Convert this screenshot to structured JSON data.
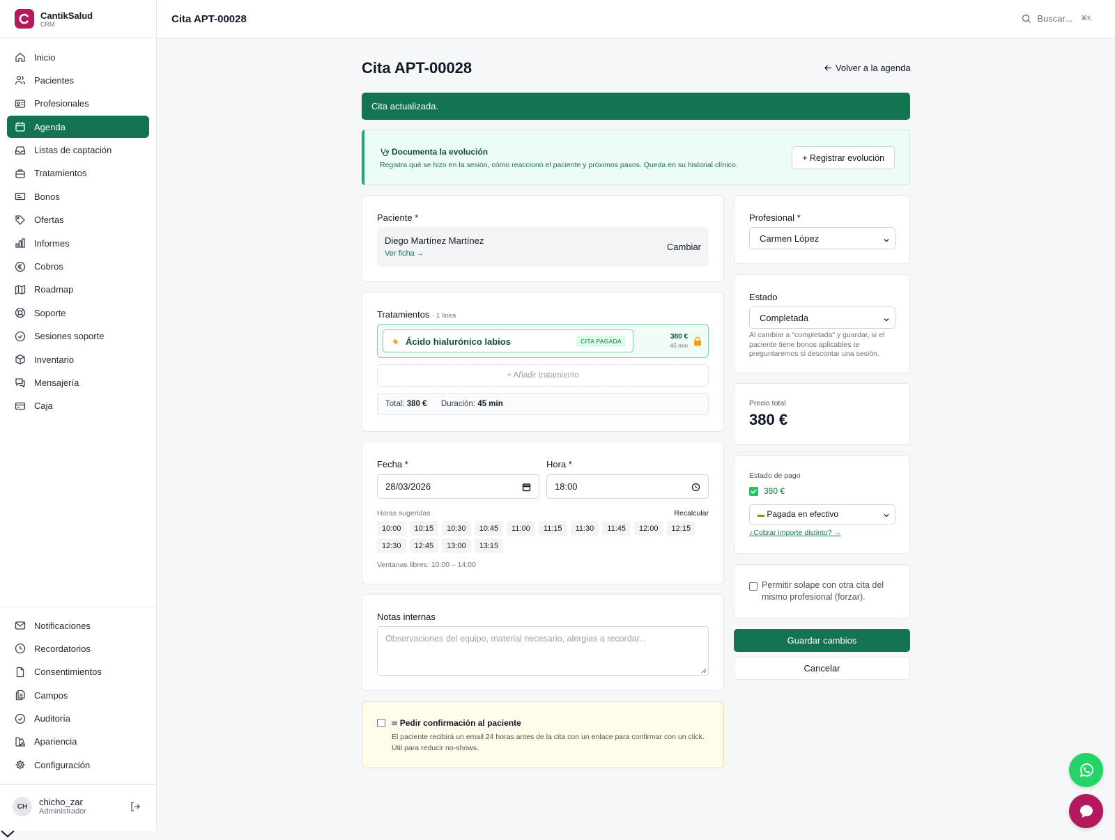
{
  "brand": {
    "name": "CantikSalud",
    "sub": "CRM"
  },
  "nav_top": [
    {
      "label": "Inicio",
      "icon": "home-icon"
    },
    {
      "label": "Pacientes",
      "icon": "users-icon"
    },
    {
      "label": "Profesionales",
      "icon": "id-card-icon"
    },
    {
      "label": "Agenda",
      "icon": "calendar-icon",
      "active": true
    },
    {
      "label": "Listas de captación",
      "icon": "inbox-icon"
    },
    {
      "label": "Tratamientos",
      "icon": "briefcase-icon"
    },
    {
      "label": "Bonos",
      "icon": "ticket-icon"
    },
    {
      "label": "Ofertas",
      "icon": "tag-icon"
    },
    {
      "label": "Informes",
      "icon": "bar-chart-icon"
    },
    {
      "label": "Cobros",
      "icon": "euro-icon"
    },
    {
      "label": "Roadmap",
      "icon": "map-icon"
    },
    {
      "label": "Soporte",
      "icon": "lifebuoy-icon"
    },
    {
      "label": "Sesiones soporte",
      "icon": "check-circle-icon"
    },
    {
      "label": "Inventario",
      "icon": "box-icon"
    },
    {
      "label": "Mensajería",
      "icon": "message-icon"
    },
    {
      "label": "Caja",
      "icon": "credit-card-icon"
    }
  ],
  "nav_bottom": [
    {
      "label": "Notificaciones",
      "icon": "mail-icon"
    },
    {
      "label": "Recordatorios",
      "icon": "clock-icon"
    },
    {
      "label": "Consentimientos",
      "icon": "file-icon"
    },
    {
      "label": "Campos",
      "icon": "files-icon"
    },
    {
      "label": "Auditoría",
      "icon": "shield-check-icon"
    },
    {
      "label": "Apariencia",
      "icon": "palette-icon"
    },
    {
      "label": "Configuración",
      "icon": "settings-icon"
    }
  ],
  "user": {
    "initials": "CH",
    "name": "chicho_zar",
    "role": "Administrador"
  },
  "topbar": {
    "title": "Cita APT-00028",
    "search_placeholder": "Buscar...",
    "shortcut": "⌘K"
  },
  "page": {
    "title": "Cita APT-00028",
    "back_label": "Volver a la agenda"
  },
  "alert": {
    "message": "Cita actualizada."
  },
  "evolution": {
    "title": "Documenta la evolución",
    "description": "Registra qué se hizo en la sesión, cómo reaccionó el paciente y próximos pasos. Queda en su historial clínico.",
    "button": "+ Registrar evolución"
  },
  "patient": {
    "label": "Paciente *",
    "name": "Diego Martínez Martínez",
    "link": "Ver ficha →",
    "change": "Cambiar"
  },
  "treatments": {
    "label": "Tratamientos",
    "count": "· 1 línea",
    "items": [
      {
        "name": "Ácido hialurónico labios",
        "badge": "CITA PAGADA",
        "price": "380 €",
        "duration": "45 min"
      }
    ],
    "add_label": "+ Añadir tratamiento",
    "total_label": "Total:",
    "total_value": "380 €",
    "duration_label": "Duración:",
    "duration_value": "45 min"
  },
  "schedule": {
    "date_label": "Fecha *",
    "date_value": "28/03/2026",
    "time_label": "Hora *",
    "time_value": "18:00",
    "suggested_label": "Horas sugeridas",
    "recalc_label": "Recalcular",
    "slots": [
      "10:00",
      "10:15",
      "10:30",
      "10:45",
      "11:00",
      "11:15",
      "11:30",
      "11:45",
      "12:00",
      "12:15",
      "12:30",
      "12:45",
      "13:00",
      "13:15"
    ],
    "windows": "Ventanas libres: 10:00 – 14:00"
  },
  "notes": {
    "label": "Notas internas",
    "placeholder": "Observaciones del equipo, material necesario, alergias a recordar..."
  },
  "confirmation": {
    "title": "Pedir confirmación al paciente",
    "description": "El paciente recibirá un email 24 horas antes de la cita con un enlace para confirmar con un click. Útil para reducir no-shows."
  },
  "professional": {
    "label": "Profesional *",
    "value": "Carmen López"
  },
  "status": {
    "label": "Estado",
    "value": "Completada",
    "hint": "Al cambiar a \"completada\" y guardar, si el paciente tiene bonos aplicables te preguntaremos si descontar una sesión."
  },
  "price": {
    "label": "Precio total",
    "value": "380 €"
  },
  "payment": {
    "label": "Estado de pago",
    "amount": "380 €",
    "method": "Pagada en efectivo",
    "link": "¿Cobrar importe distinto? →"
  },
  "overlap": {
    "label": "Permitir solape con otra cita del mismo profesional (forzar)."
  },
  "actions": {
    "save": "Guardar cambios",
    "cancel": "Cancelar"
  },
  "colors": {
    "primary": "#137450",
    "brand": "#b4185d",
    "whatsapp": "#25d366",
    "chat": "#b4185d"
  }
}
